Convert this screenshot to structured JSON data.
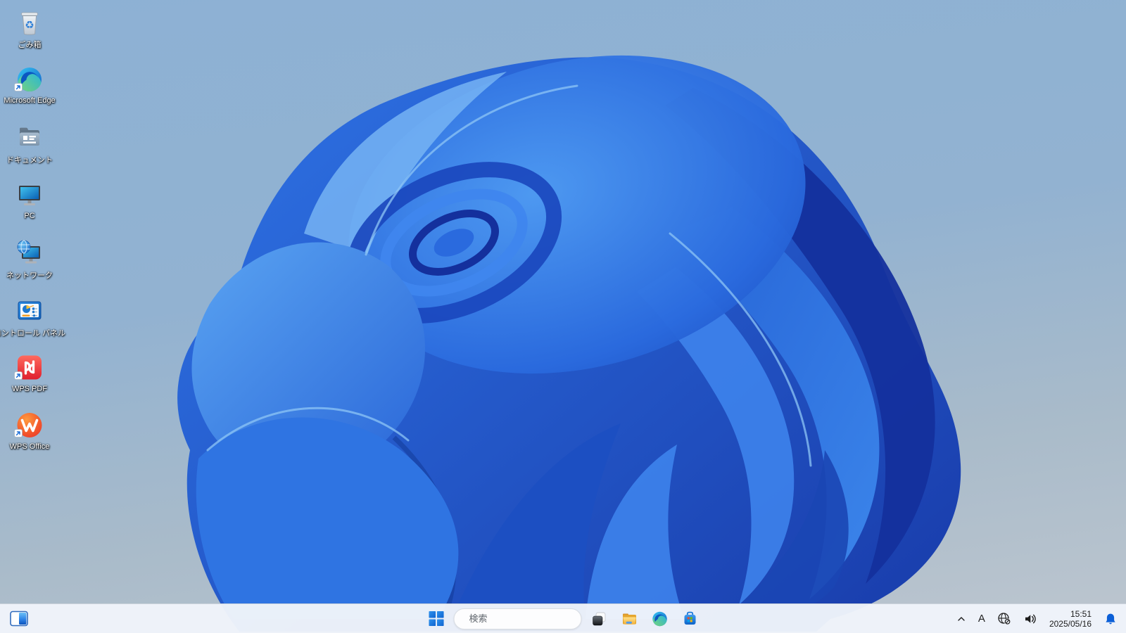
{
  "desktop": {
    "wallpaper": "windows-11-blue-bloom",
    "icons": [
      {
        "label": "ごみ箱",
        "icon": "recycle-bin-icon",
        "shortcut": false
      },
      {
        "label": "Microsoft Edge",
        "icon": "edge-icon",
        "shortcut": true
      },
      {
        "label": "ドキュメント",
        "icon": "documents-folder-icon",
        "shortcut": false
      },
      {
        "label": "PC",
        "icon": "pc-monitor-icon",
        "shortcut": false
      },
      {
        "label": "ネットワーク",
        "icon": "network-icon",
        "shortcut": false
      },
      {
        "label": "コントロール パネル",
        "icon": "control-panel-icon",
        "shortcut": false
      },
      {
        "label": "WPS PDF",
        "icon": "wps-pdf-icon",
        "shortcut": true
      },
      {
        "label": "WPS Office",
        "icon": "wps-office-icon",
        "shortcut": true
      }
    ]
  },
  "taskbar": {
    "widgets_button": {
      "icon": "widgets-icon"
    },
    "start_button": {
      "icon": "windows-start-icon"
    },
    "search": {
      "placeholder": "検索",
      "icon": "search-icon"
    },
    "pinned_buttons": [
      {
        "icon": "task-view-icon"
      },
      {
        "icon": "file-explorer-icon"
      },
      {
        "icon": "edge-icon"
      },
      {
        "icon": "microsoft-store-icon"
      }
    ],
    "tray": {
      "hidden_icons": {
        "icon": "chevron-up-icon"
      },
      "ime_mode": "A",
      "network": {
        "icon": "globe-no-internet-icon"
      },
      "volume": {
        "icon": "speaker-icon"
      },
      "clock": {
        "time": "15:51",
        "date": "2025/05/16"
      },
      "notifications": {
        "icon": "bell-icon"
      }
    }
  },
  "colors": {
    "taskbar_bg": "#f0f4fa",
    "accent_blue": "#1672d9",
    "bell_blue": "#0b5fd7",
    "wallpaper_top": "#8db1d4",
    "wallpaper_bottom": "#bdc6cf",
    "bloom_deep": "#16339e",
    "bloom_bright": "#74b7f4"
  }
}
